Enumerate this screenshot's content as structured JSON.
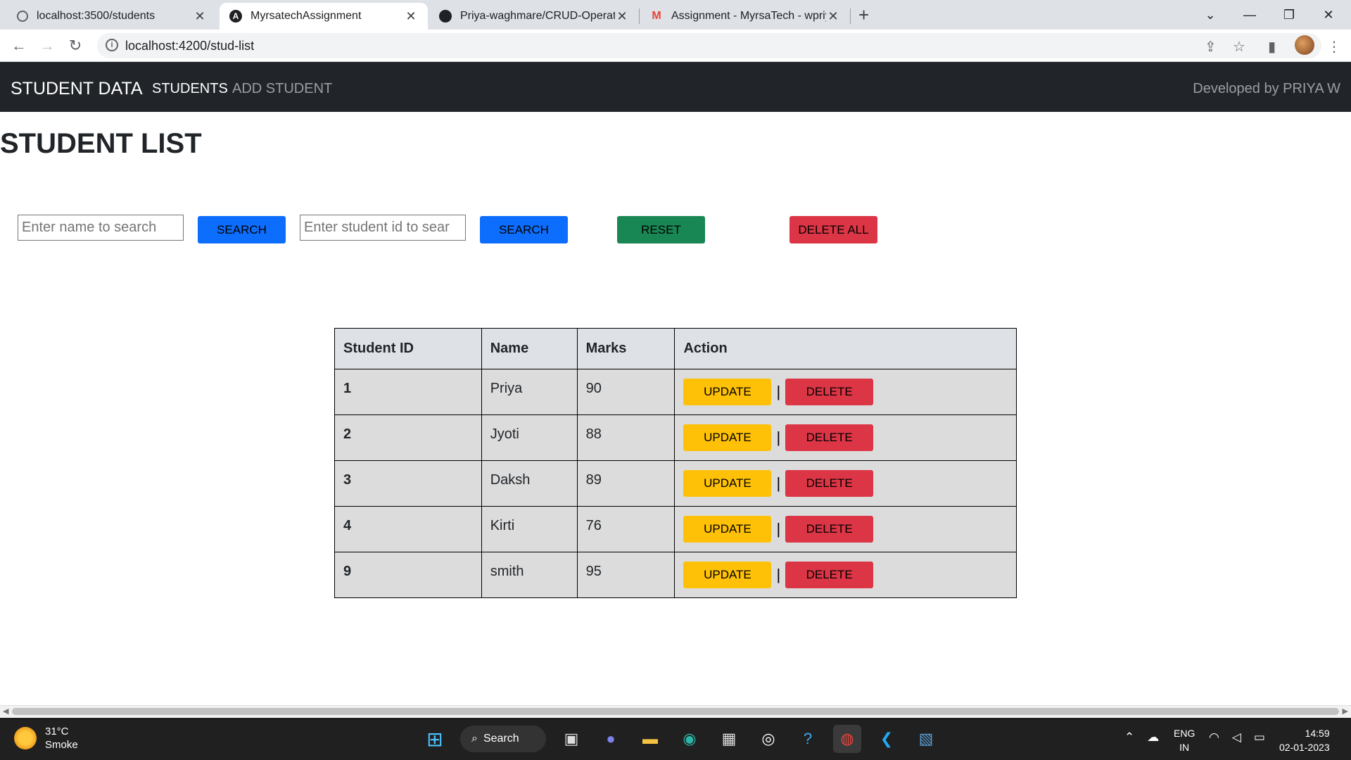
{
  "browser": {
    "tabs": [
      {
        "title": "localhost:3500/students",
        "active": false
      },
      {
        "title": "MyrsatechAssignment",
        "active": true
      },
      {
        "title": "Priya-waghmare/CRUD-Operatio",
        "active": false
      },
      {
        "title": "Assignment - MyrsaTech - wpriya",
        "active": false
      }
    ],
    "url": "localhost:4200/stud-list"
  },
  "navbar": {
    "brand": "STUDENT DATA",
    "links": [
      "STUDENTS",
      "ADD STUDENT"
    ],
    "credit": "Developed by PRIYA W"
  },
  "page": {
    "title": "STUDENT LIST",
    "name_search_placeholder": "Enter name to search",
    "id_search_placeholder": "Enter student id to sear",
    "search_label": "SEARCH",
    "reset_label": "RESET",
    "delete_all_label": "DELETE ALL"
  },
  "table": {
    "headers": [
      "Student ID",
      "Name",
      "Marks",
      "Action"
    ],
    "update_label": "UPDATE",
    "delete_label": "DELETE",
    "separator": "|",
    "rows": [
      {
        "id": "1",
        "name": "Priya",
        "marks": "90"
      },
      {
        "id": "2",
        "name": "Jyoti",
        "marks": "88"
      },
      {
        "id": "3",
        "name": "Daksh",
        "marks": "89"
      },
      {
        "id": "4",
        "name": "Kirti",
        "marks": "76"
      },
      {
        "id": "9",
        "name": "smith",
        "marks": "95"
      }
    ]
  },
  "taskbar": {
    "temp": "31°C",
    "condition": "Smoke",
    "search_label": "Search",
    "lang1": "ENG",
    "lang2": "IN",
    "time": "14:59",
    "date": "02-01-2023"
  },
  "colors": {
    "primary": "#0d6efd",
    "success": "#198754",
    "danger": "#dc3545",
    "warning": "#ffc107",
    "navbar": "#212529"
  }
}
